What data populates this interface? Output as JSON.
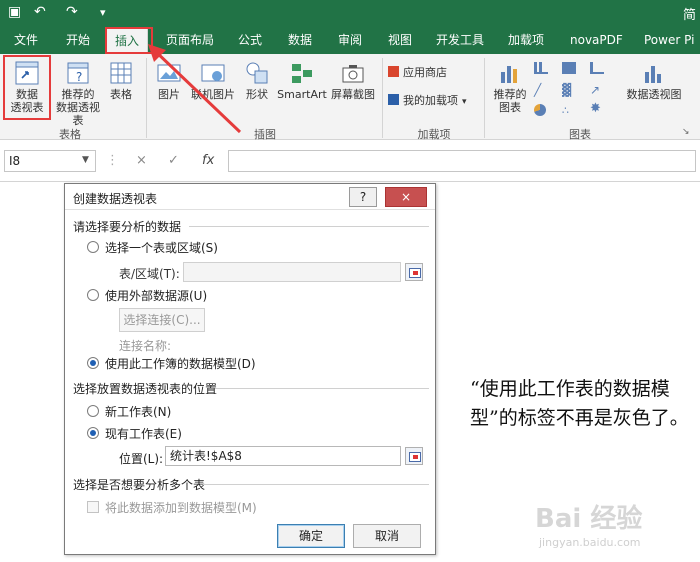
{
  "window": {
    "title_partial": "简"
  },
  "ribbon": {
    "tabs": [
      "文件",
      "开始",
      "插入",
      "页面布局",
      "公式",
      "数据",
      "审阅",
      "视图",
      "开发工具",
      "加载项",
      "novaPDF",
      "Power Pi"
    ],
    "active_tab": "插入",
    "groups": {
      "tables": {
        "label": "表格",
        "pivot_table": "数据\n透视表",
        "recommended_pivot": "推荐的\n数据透视表",
        "table": "表格"
      },
      "illustrations": {
        "label": "插图",
        "pictures": "图片",
        "online_pictures": "联机图片",
        "shapes": "形状",
        "smartart": "SmartArt",
        "screenshot": "屏幕截图"
      },
      "addins": {
        "label": "加载项",
        "store": "应用商店",
        "my_addins": "我的加载项"
      },
      "charts": {
        "label": "图表",
        "recommended_charts": "推荐的\n图表",
        "pivot_chart": "数据透视图"
      }
    }
  },
  "formula_bar": {
    "name_box": "I8",
    "fx": "fx",
    "cancel": "×",
    "enter": "✓",
    "value": ""
  },
  "dialog": {
    "title": "创建数据透视表",
    "help": "?",
    "close": "×",
    "section_choose_data": "请选择要分析的数据",
    "opt_table_range": "选择一个表或区域(S)",
    "label_table_range": "表/区域(T):",
    "table_range_value": "",
    "opt_external": "使用外部数据源(U)",
    "btn_choose_connection": "选择连接(C)...",
    "label_connection_name": "连接名称:",
    "opt_data_model": "使用此工作簿的数据模型(D)",
    "section_location": "选择放置数据透视表的位置",
    "opt_new_sheet": "新工作表(N)",
    "opt_existing_sheet": "现有工作表(E)",
    "label_location": "位置(L):",
    "location_value": "统计表!$A$8",
    "section_multi": "选择是否想要分析多个表",
    "chk_add_to_model": "将此数据添加到数据模型(M)",
    "btn_ok": "确定",
    "btn_cancel": "取消",
    "selected_source": "data_model",
    "selected_location": "existing_sheet"
  },
  "annotation": {
    "text": "“使用此工作表的数据模型”的标签不再是灰色了。"
  },
  "colors": {
    "excel_green": "#217346",
    "highlight_red": "#e53b3b",
    "ribbon_bg": "#f3f3f3"
  },
  "watermark": {
    "brand": "Bai 经验",
    "site": "jingyan.baidu.com"
  }
}
